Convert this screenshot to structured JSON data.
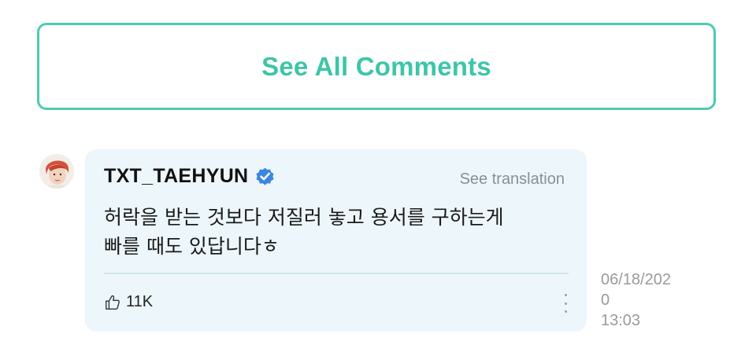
{
  "see_all": {
    "label": "See All Comments"
  },
  "comment": {
    "author": "TXT_TAEHYUN",
    "verified_icon": "verified-badge-icon",
    "translate_label": "See translation",
    "text_line1": "허락을 받는 것보다 저질러 놓고 용서를 구하는게",
    "text_line2": "빠를 때도 있답니다ㅎ",
    "like_icon": "thumbs-up-icon",
    "like_count": "11K",
    "more_icon": "more-vertical-icon",
    "date_line1": "06/18/202",
    "date_line2": "0",
    "time": "13:03"
  },
  "colors": {
    "accent": "#3ec5a8",
    "bubble_bg": "#edf7fb",
    "verified_blue": "#3b86e0"
  }
}
